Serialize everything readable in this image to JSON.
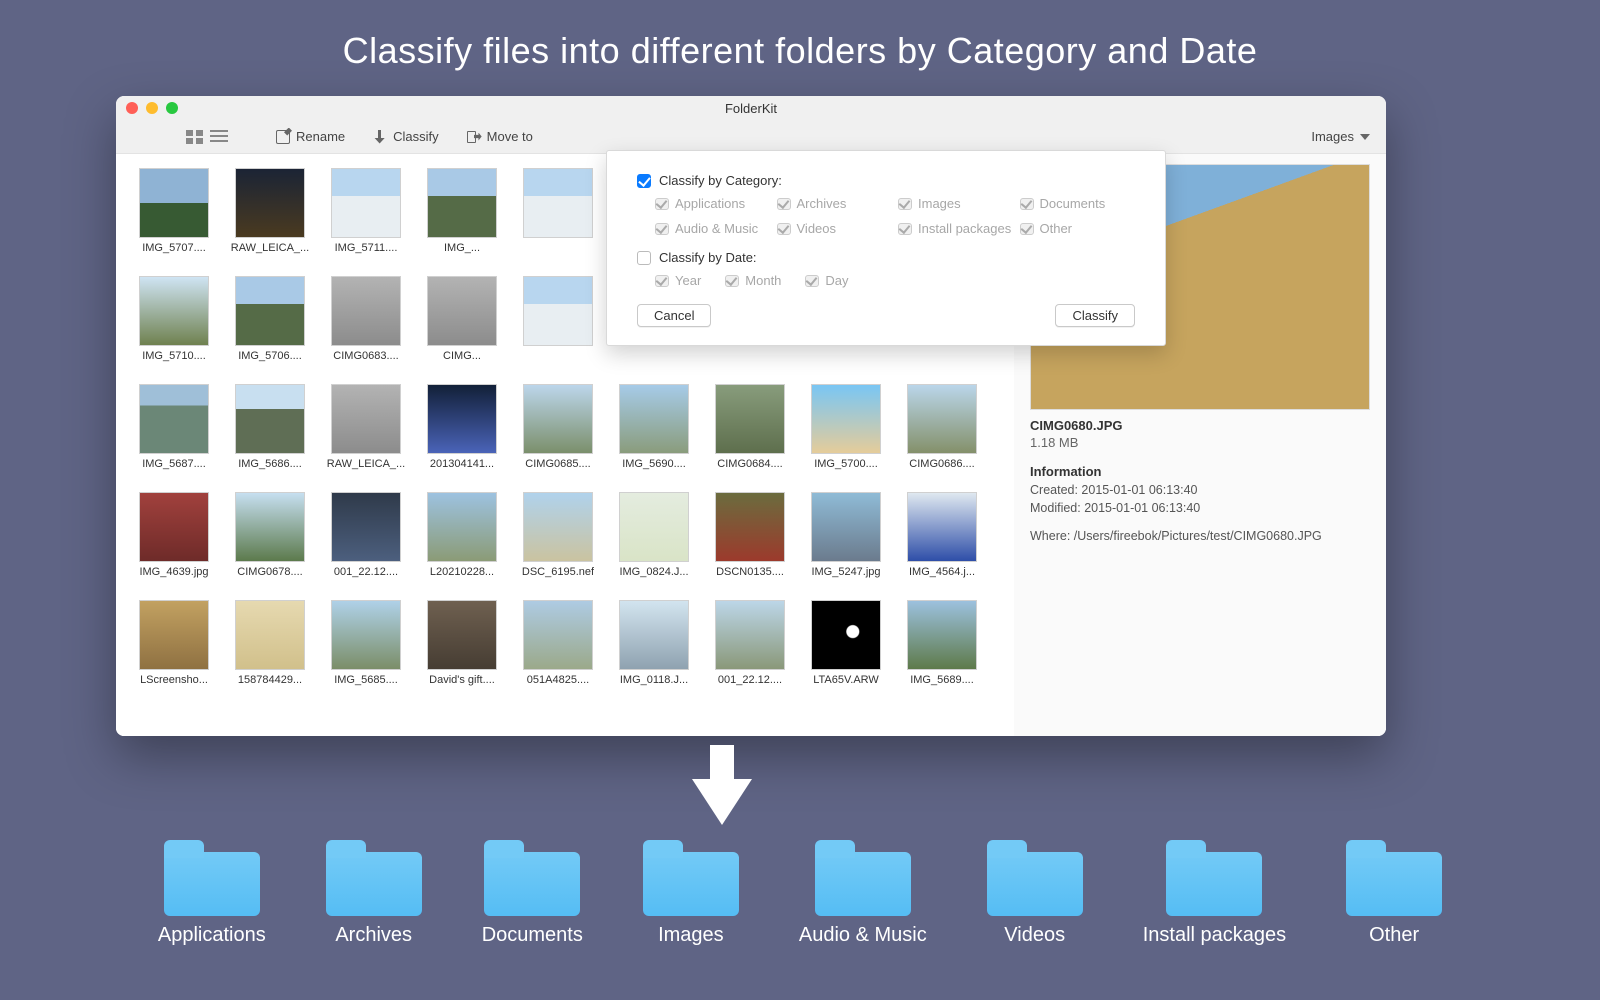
{
  "headline": "Classify files into different folders by Category and Date",
  "app_title": "FolderKit",
  "toolbar": {
    "rename": "Rename",
    "classify": "Classify",
    "moveto": "Move to",
    "filter_label": "Images"
  },
  "popover": {
    "by_category_label": "Classify by Category:",
    "categories": [
      "Applications",
      "Archives",
      "Images",
      "Documents",
      "Audio & Music",
      "Videos",
      "Install packages",
      "Other"
    ],
    "by_date_label": "Classify by Date:",
    "date_parts": [
      "Year",
      "Month",
      "Day"
    ],
    "cancel": "Cancel",
    "confirm": "Classify"
  },
  "thumbnails": [
    "IMG_5707....",
    "RAW_LEICA_...",
    "IMG_5711....",
    "IMG_...",
    "",
    "",
    "",
    "",
    "",
    "IMG_5710....",
    "IMG_5706....",
    "CIMG0683....",
    "CIMG...",
    "",
    "",
    "",
    "",
    "",
    "IMG_5687....",
    "IMG_5686....",
    "RAW_LEICA_...",
    "201304141...",
    "CIMG0685....",
    "IMG_5690....",
    "CIMG0684....",
    "IMG_5700....",
    "CIMG0686....",
    "IMG_4639.jpg",
    "CIMG0678....",
    "001_22.12....",
    "L20210228...",
    "DSC_6195.nef",
    "IMG_0824.J...",
    "DSCN0135....",
    "IMG_5247.jpg",
    "IMG_4564.j...",
    "LScreensho...",
    "158784429...",
    "IMG_5685....",
    "David's gift....",
    "051A4825....",
    "IMG_0118.J...",
    "001_22.12....",
    "LTA65V.ARW",
    "IMG_5689...."
  ],
  "detail": {
    "filename": "CIMG0680.JPG",
    "size": "1.18 MB",
    "info_heading": "Information",
    "created": "Created: 2015-01-01 06:13:40",
    "modified": "Modified: 2015-01-01 06:13:40",
    "where": "Where: /Users/fireebok/Pictures/test/CIMG0680.JPG"
  },
  "folders": [
    "Applications",
    "Archives",
    "Documents",
    "Images",
    "Audio & Music",
    "Videos",
    "Install packages",
    "Other"
  ]
}
